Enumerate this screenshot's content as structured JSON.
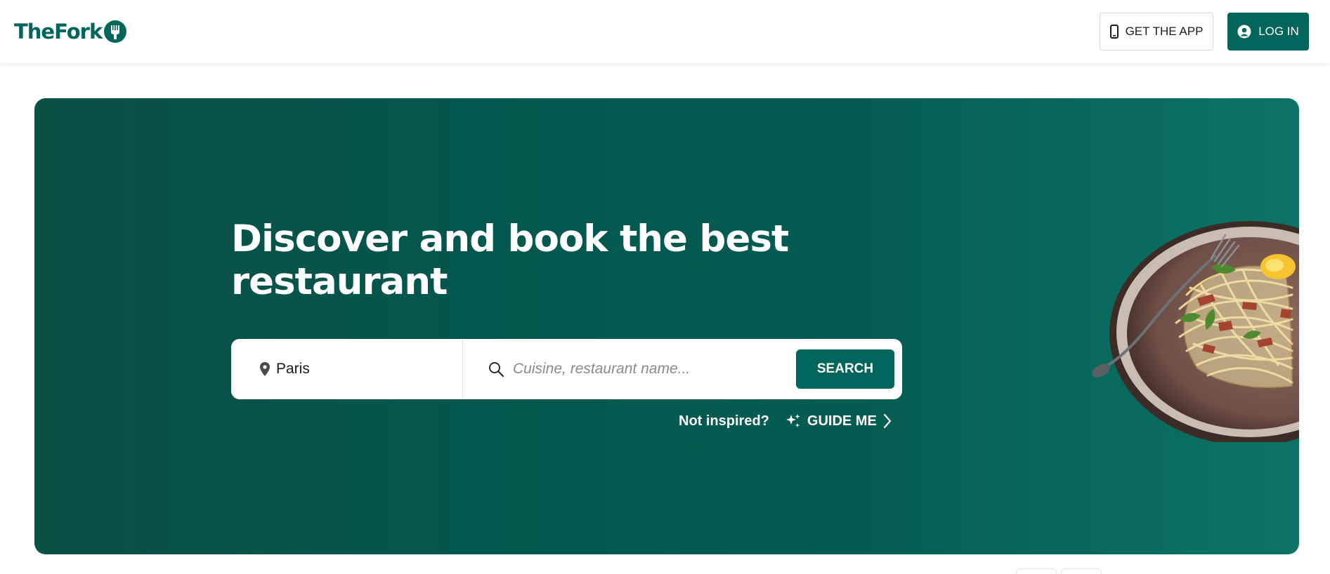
{
  "header": {
    "logo_text": "TheFork",
    "get_app_label": "GET THE APP",
    "login_label": "LOG IN"
  },
  "hero": {
    "title": "Discover and book the best restaurant",
    "location_value": "Paris",
    "query_placeholder": "Cuisine, restaurant name...",
    "search_label": "SEARCH",
    "not_inspired_text": "Not inspired?",
    "guide_label": "GUIDE ME"
  },
  "icons": {
    "logo": "fork-logo-icon",
    "phone": "phone-icon",
    "user": "user-icon",
    "location": "map-pin-icon",
    "search": "search-icon",
    "sparkle": "sparkle-icon",
    "chevron": "chevron-right-icon"
  },
  "colors": {
    "brand": "#00665c",
    "hero_bg": "#04574e",
    "text_dark": "#1c1c1c",
    "placeholder": "#8a8a8a"
  }
}
